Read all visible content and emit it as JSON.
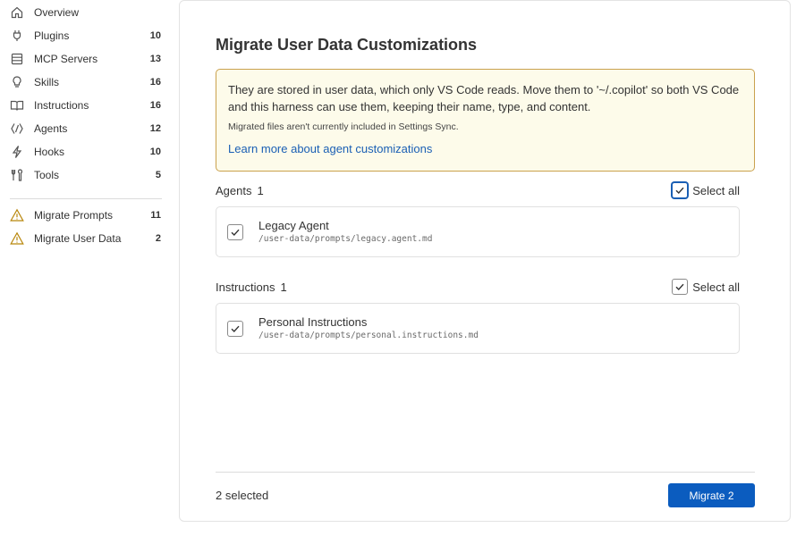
{
  "sidebar": {
    "items": [
      {
        "label": "Overview",
        "count": "",
        "icon": "home-icon"
      },
      {
        "label": "Plugins",
        "count": "10",
        "icon": "plug-icon"
      },
      {
        "label": "MCP Servers",
        "count": "13",
        "icon": "server-icon"
      },
      {
        "label": "Skills",
        "count": "16",
        "icon": "lightbulb-icon"
      },
      {
        "label": "Instructions",
        "count": "16",
        "icon": "book-icon"
      },
      {
        "label": "Agents",
        "count": "12",
        "icon": "agent-icon"
      },
      {
        "label": "Hooks",
        "count": "10",
        "icon": "lightning-icon"
      },
      {
        "label": "Tools",
        "count": "5",
        "icon": "tools-icon"
      },
      {
        "label": "Migrate Prompts",
        "count": "11",
        "icon": "warning-icon"
      },
      {
        "label": "Migrate User Data",
        "count": "2",
        "icon": "warning-icon"
      }
    ]
  },
  "main": {
    "title": "Migrate User Data Customizations",
    "notice": {
      "text": "They are stored in user data, which only VS Code reads. Move them to '~/.copilot' so both VS Code and this harness can use them, keeping their name, type, and content.",
      "subtext": "Migrated files aren't currently included in Settings Sync.",
      "link": "Learn more about agent customizations"
    },
    "groups": [
      {
        "name": "Agents",
        "count": "1",
        "select_all_label": "Select all",
        "select_all_checked": true,
        "items": [
          {
            "name": "Legacy Agent",
            "path": "/user-data/prompts/legacy.agent.md",
            "checked": true
          }
        ]
      },
      {
        "name": "Instructions",
        "count": "1",
        "select_all_label": "Select all",
        "select_all_checked": true,
        "items": [
          {
            "name": "Personal Instructions",
            "path": "/user-data/prompts/personal.instructions.md",
            "checked": true
          }
        ]
      }
    ],
    "footer": {
      "status": "2 selected",
      "button_label": "Migrate 2"
    }
  },
  "colors": {
    "accent": "#0b5cbf",
    "link": "#1a5fb4",
    "notice_bg": "#fdfbea",
    "notice_border": "#caa14d",
    "warning": "#b8860b"
  }
}
